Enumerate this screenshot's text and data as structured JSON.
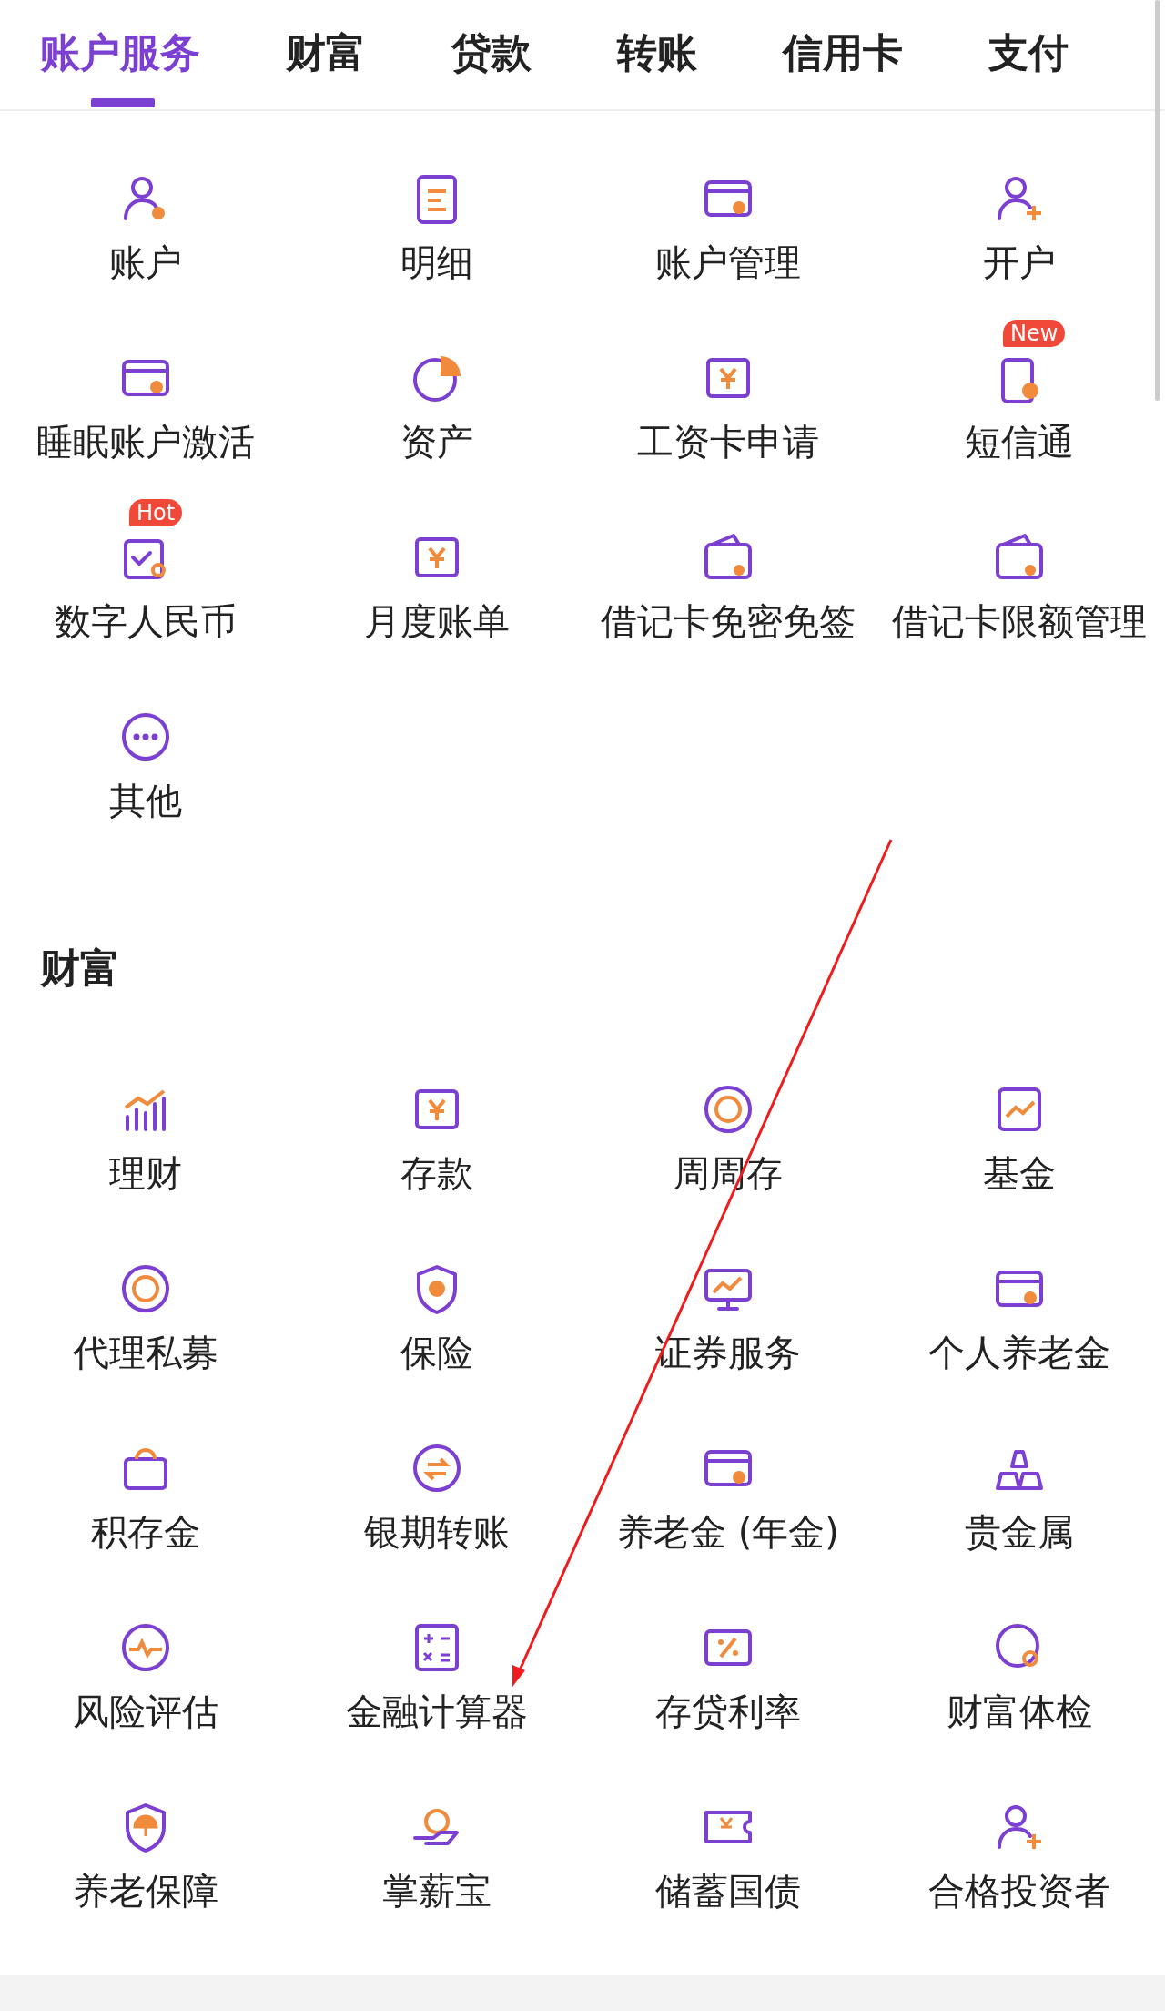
{
  "tabs": [
    {
      "label": "账户服务",
      "selected": true
    },
    {
      "label": "财富",
      "selected": false
    },
    {
      "label": "贷款",
      "selected": false
    },
    {
      "label": "转账",
      "selected": false
    },
    {
      "label": "信用卡",
      "selected": false
    },
    {
      "label": "支付",
      "selected": false
    }
  ],
  "sections": [
    {
      "items": [
        {
          "label": "账户"
        },
        {
          "label": "明细"
        },
        {
          "label": "账户管理"
        },
        {
          "label": "开户"
        },
        {
          "label": "睡眠账户激活"
        },
        {
          "label": "资产"
        },
        {
          "label": "工资卡申请"
        },
        {
          "label": "短信通",
          "badge": "New"
        },
        {
          "label": "数字人民币",
          "badge": "Hot"
        },
        {
          "label": "月度账单"
        },
        {
          "label": "借记卡免密免签"
        },
        {
          "label": "借记卡限额管理"
        },
        {
          "label": "其他"
        }
      ]
    },
    {
      "title": "财富",
      "items": [
        {
          "label": "理财"
        },
        {
          "label": "存款"
        },
        {
          "label": "周周存"
        },
        {
          "label": "基金"
        },
        {
          "label": "代理私募"
        },
        {
          "label": "保险"
        },
        {
          "label": "证券服务"
        },
        {
          "label": "个人养老金"
        },
        {
          "label": "积存金"
        },
        {
          "label": "银期转账"
        },
        {
          "label": "养老金 (年金)"
        },
        {
          "label": "贵金属"
        },
        {
          "label": "风险评估"
        },
        {
          "label": "金融计算器"
        },
        {
          "label": "存贷利率"
        },
        {
          "label": "财富体检"
        },
        {
          "label": "养老保障"
        },
        {
          "label": "掌薪宝"
        },
        {
          "label": "储蓄国债"
        },
        {
          "label": "合格投资者"
        }
      ]
    }
  ]
}
